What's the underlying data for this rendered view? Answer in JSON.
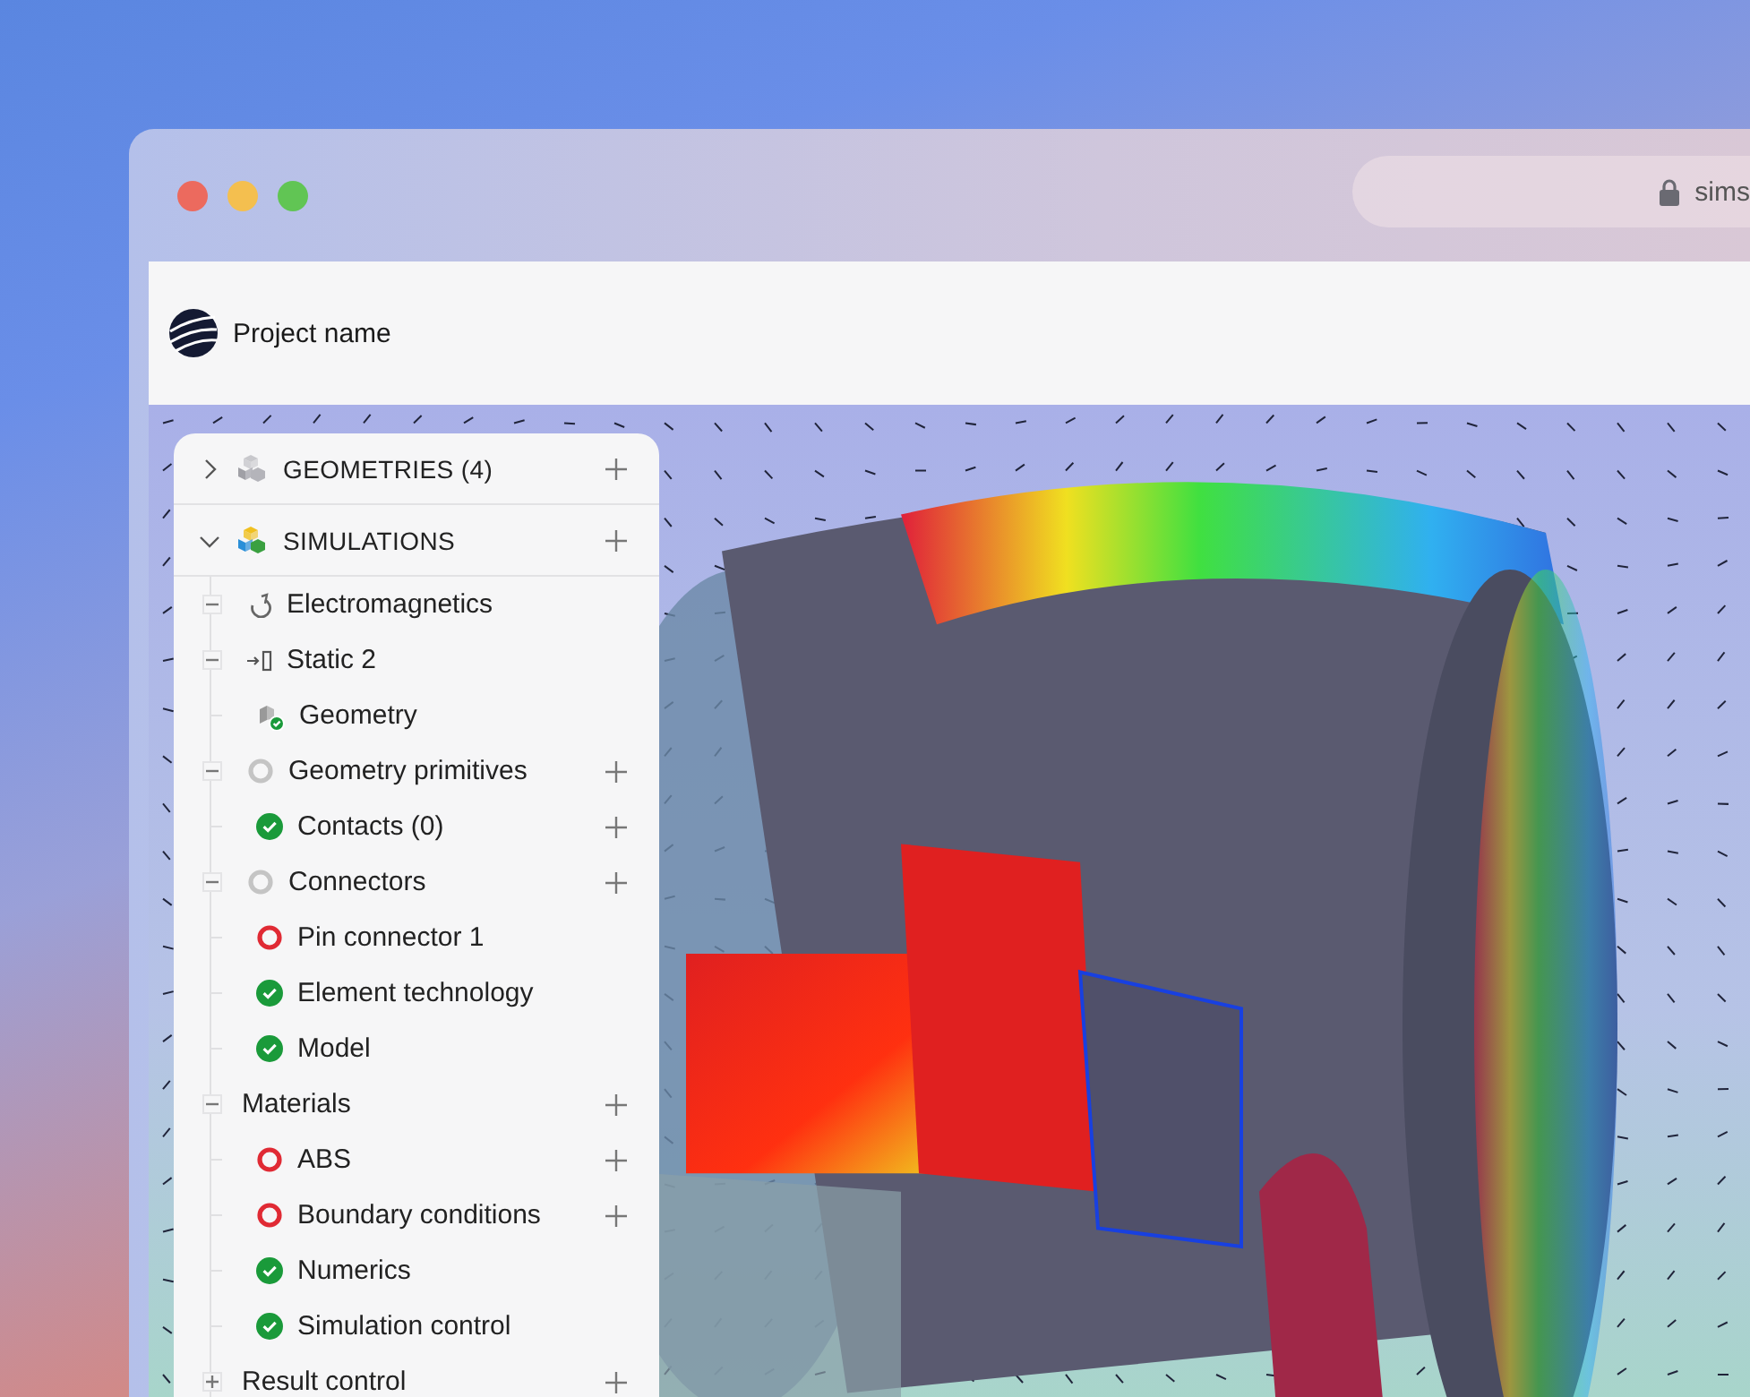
{
  "window": {
    "address": "sims"
  },
  "header": {
    "project_name": "Project name"
  },
  "tree": {
    "sections": [
      {
        "label": "GEOMETRIES (4)",
        "expanded": false,
        "kind": "cubes-grey",
        "add": true
      },
      {
        "label": "SIMULATIONS",
        "expanded": true,
        "kind": "cubes-color",
        "add": true,
        "children": [
          {
            "label": "Electromagnetics",
            "kind": "magnet",
            "expanded": true,
            "add": false
          },
          {
            "label": "Static 2",
            "kind": "step",
            "expanded": true,
            "add": false
          },
          {
            "label": "Geometry",
            "kind": "geometry",
            "add": false
          },
          {
            "label": "Geometry primitives",
            "kind": "pending",
            "expanded": true,
            "add": true
          },
          {
            "label": "Contacts (0)",
            "kind": "ok",
            "add": true
          },
          {
            "label": "Connectors",
            "kind": "pending",
            "expanded": true,
            "add": true
          },
          {
            "label": "Pin connector 1",
            "kind": "error",
            "add": false
          },
          {
            "label": "Element technology",
            "kind": "ok",
            "add": false
          },
          {
            "label": "Model",
            "kind": "ok",
            "add": false
          },
          {
            "label": "Materials",
            "kind": "none",
            "expanded": true,
            "add": true
          },
          {
            "label": "ABS",
            "kind": "error",
            "add": true
          },
          {
            "label": "Boundary conditions",
            "kind": "error",
            "add": true
          },
          {
            "label": "Numerics",
            "kind": "ok",
            "add": false
          },
          {
            "label": "Simulation control",
            "kind": "ok",
            "add": false
          },
          {
            "label": "Result control",
            "kind": "none",
            "expanded": false,
            "add": true
          }
        ]
      }
    ]
  }
}
